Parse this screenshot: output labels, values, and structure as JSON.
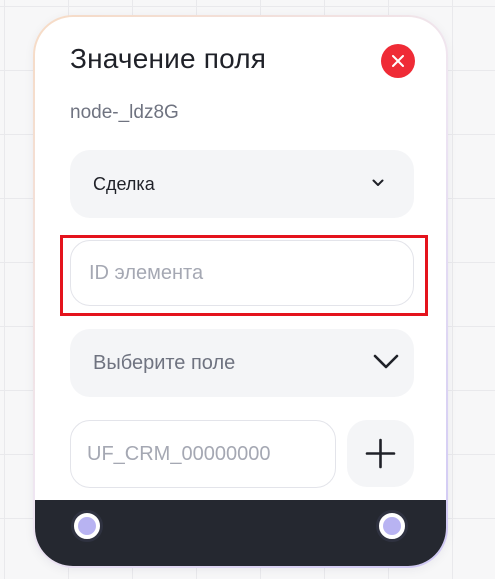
{
  "node": {
    "title": "Значение поля",
    "id_label": "node-_ldz8G",
    "entity_select": {
      "value": "Сделка",
      "icon": "chevron-down-icon"
    },
    "element_id_input": {
      "value": "",
      "placeholder": "ID элемента"
    },
    "field_select": {
      "placeholder": "Выберите поле",
      "icon": "chevron-down-icon"
    },
    "field_code_input": {
      "value": "",
      "placeholder": "UF_CRM_00000000"
    },
    "add_button_icon": "plus-icon",
    "close_button_icon": "close-icon",
    "ports": [
      "input-port",
      "output-port"
    ]
  },
  "colors": {
    "close_button": "#ef2b36",
    "highlight_border": "#e4131d",
    "footer_background": "#252830",
    "port_fill": "#b8b3f2"
  }
}
